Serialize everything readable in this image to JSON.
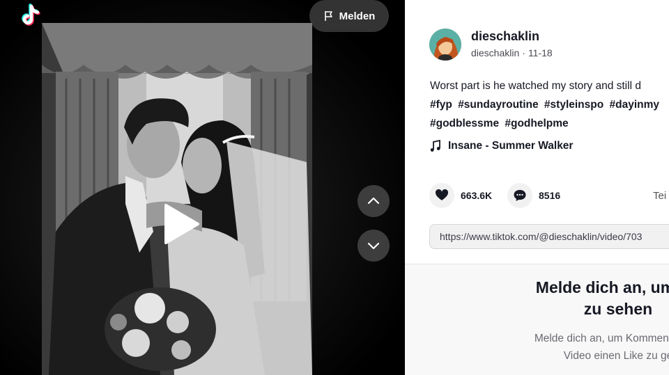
{
  "header": {
    "report_label": "Melden"
  },
  "video": {
    "state": "paused"
  },
  "author": {
    "username": "dieschaklin",
    "handle": "dieschaklin",
    "date": "11-18"
  },
  "description": {
    "text": "Worst part is he watched my story and still d",
    "hashtags_line1": [
      "#fyp",
      "#sundayroutine",
      "#styleinspo",
      "#dayinmy"
    ],
    "hashtags_line2": [
      "#godblessme",
      "#godhelpme"
    ]
  },
  "music": {
    "title": "Insane - Summer Walker"
  },
  "stats": {
    "likes": "663.6K",
    "comments": "8516",
    "share_label": "Tei"
  },
  "link": {
    "url": "https://www.tiktok.com/@dieschaklin/video/703"
  },
  "login_prompt": {
    "title_line1": "Melde dich an, um Ko",
    "title_line2": "zu sehen",
    "sub_line1": "Melde dich an, um Kommentare zu",
    "sub_line2": "Video einen Like zu ge"
  },
  "colors": {
    "brand_cyan": "#25F4EE",
    "brand_red": "#FE2C55",
    "text_primary": "#161823"
  }
}
